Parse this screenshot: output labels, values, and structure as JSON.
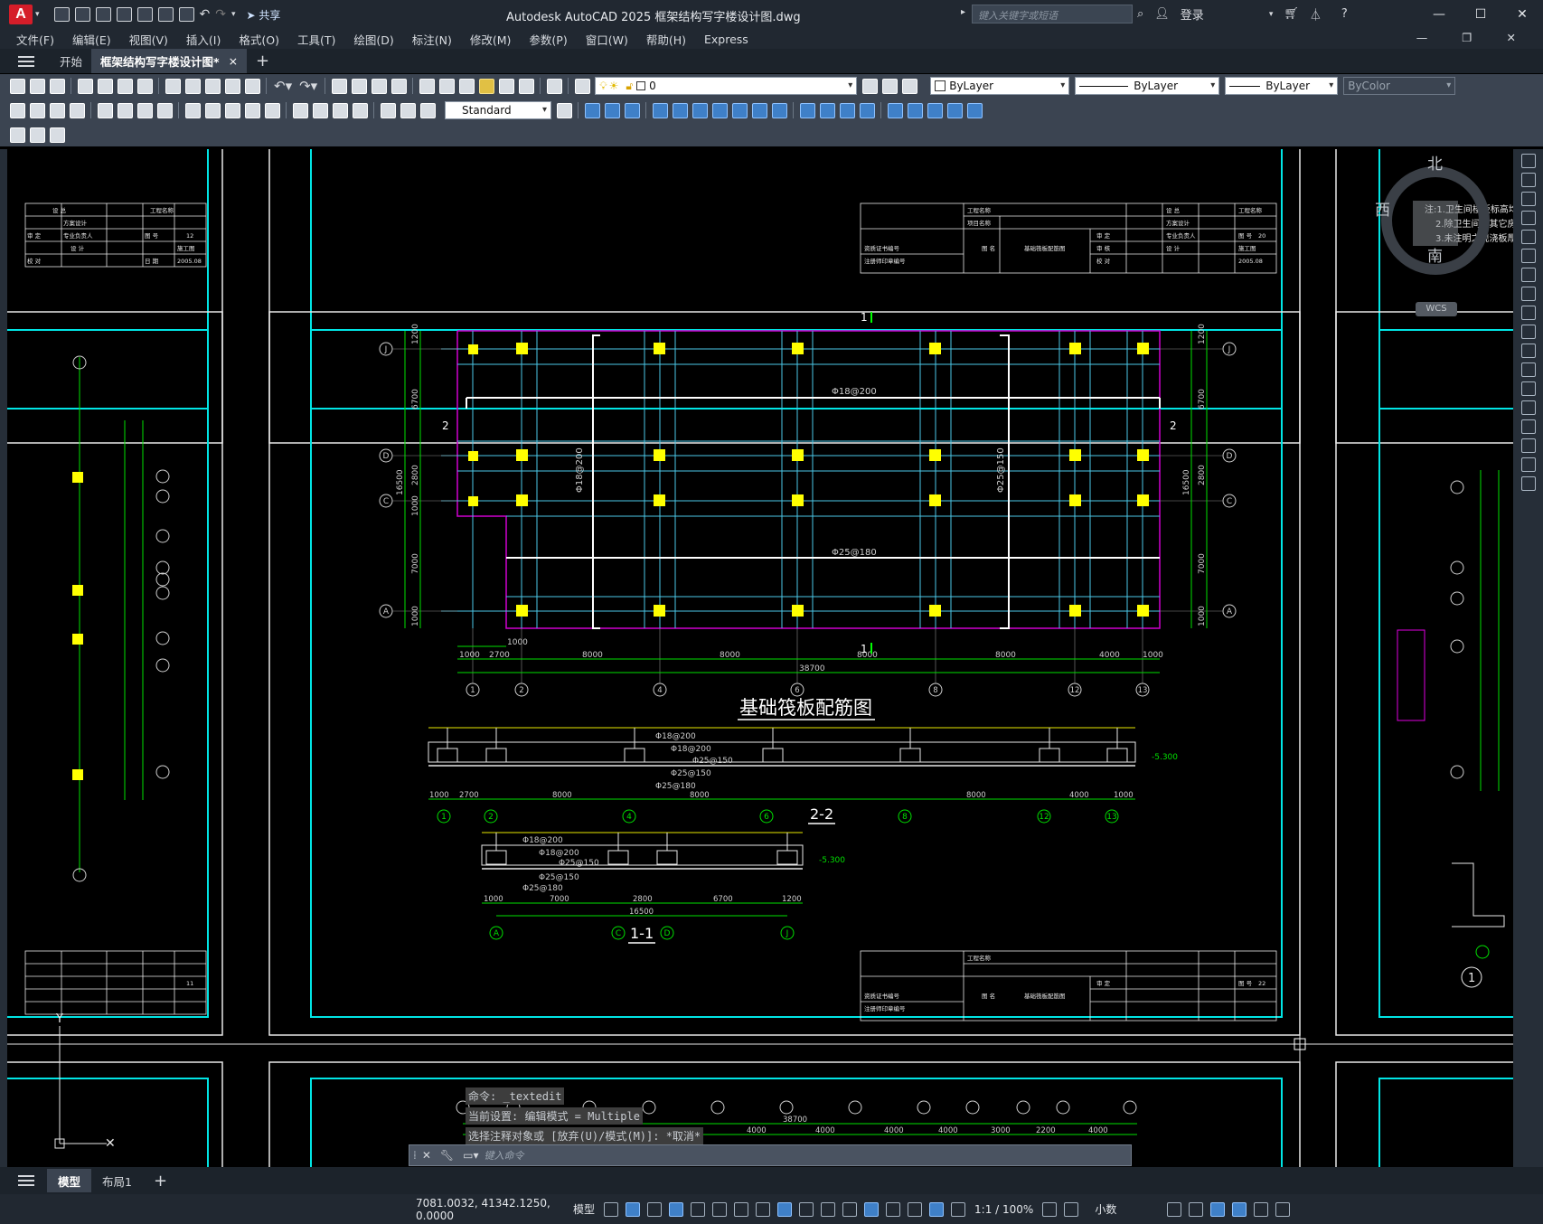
{
  "window": {
    "app_logo": "A",
    "share_label": "共享",
    "title": "Autodesk AutoCAD 2025    框架结构写字楼设计图.dwg",
    "search_placeholder": "键入关键字或短语",
    "login_label": "登录"
  },
  "menu": {
    "items": [
      "文件(F)",
      "编辑(E)",
      "视图(V)",
      "插入(I)",
      "格式(O)",
      "工具(T)",
      "绘图(D)",
      "标注(N)",
      "修改(M)",
      "参数(P)",
      "窗口(W)",
      "帮助(H)",
      "Express"
    ]
  },
  "tabs": {
    "start": "开始",
    "doc": "框架结构写字楼设计图*",
    "close_glyph": "×",
    "add_glyph": "+"
  },
  "toolbar": {
    "layer_value": "0",
    "text_style": "Standard",
    "color": "ByLayer",
    "linetype": "ByLayer",
    "lineweight": "ByLayer",
    "plotstyle": "ByColor"
  },
  "drawing": {
    "main_title": "基础筏板配筋图",
    "section_2": "2-2",
    "section_1": "1-1",
    "grid_top": [
      "J",
      "D",
      "C",
      "A"
    ],
    "grid_bottom": [
      "1",
      "2",
      "4",
      "6",
      "8",
      "12",
      "13"
    ],
    "left_dims": [
      "1200",
      "6700",
      "2800",
      "1000",
      "7000",
      "1000"
    ],
    "left_total": "16500",
    "bottom_dims": [
      "1000",
      "2700",
      "8000",
      "8000",
      "8000",
      "8000",
      "4000",
      "1000"
    ],
    "bottom_total": "38700",
    "rebar_top": "Φ18@200",
    "rebar_bottom": "Φ25@180",
    "rebar_mid": "Φ25@150",
    "rebar_left": "Φ18@200",
    "section_marks": [
      "1",
      "1",
      "2",
      "2"
    ],
    "s22_dims": [
      "1000",
      "2700",
      "8000",
      "8000",
      "8000",
      "4000",
      "1000"
    ],
    "s11_dims": [
      "1000",
      "7000",
      "2800",
      "6700",
      "1200"
    ],
    "s11_total": "16500",
    "elev": "-5.300",
    "tb_labels": [
      "工程名称",
      "项目名称",
      "设 总",
      "方案设计",
      "专业负责人",
      "设 计",
      "图 号",
      "施工图",
      "审 定",
      "审 核",
      "校 对",
      "日 期",
      "图 名",
      "基础筏板配筋图",
      "2005.08",
      "资质证书编号",
      "注册师印章编号"
    ],
    "tb_numbers": [
      "12",
      "11",
      "20",
      "22"
    ],
    "right_note": [
      "注:1.卫生间楼板标高均为",
      "2.除卫生间外其它房间现",
      "3.未注明之现浇板厚120"
    ],
    "detail_label": "1",
    "bottom_strip_dims": [
      "4000",
      "4000",
      "4000",
      "4000",
      "3000",
      "2200",
      "4000"
    ],
    "bottom_strip_total": "38700"
  },
  "compass": {
    "n": "北",
    "w": "西",
    "s": "南",
    "wcs": "WCS"
  },
  "command": {
    "history": [
      "命令: _textedit",
      "当前设置: 编辑模式 = Multiple",
      "选择注释对象或 [放弃(U)/模式(M)]: *取消*"
    ],
    "placeholder": "键入命令"
  },
  "layout_tabs": {
    "model": "模型",
    "layout1": "布局1",
    "add": "+"
  },
  "status": {
    "coords": "7081.0032, 41342.1250, 0.0000",
    "model": "模型",
    "scale": "1:1 / 100%",
    "units": "小数"
  }
}
